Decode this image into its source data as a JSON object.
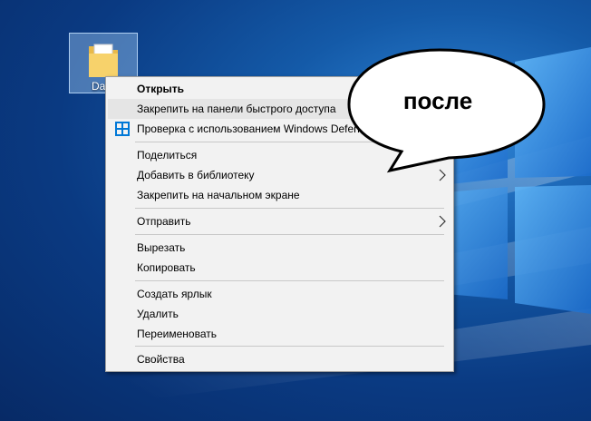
{
  "desktop": {
    "icon_label": "Da"
  },
  "context_menu": {
    "items": [
      {
        "label": "Открыть"
      },
      {
        "label": "Закрепить на панели быстрого доступа"
      },
      {
        "label": "Проверка с использованием Windows Defender..."
      },
      {
        "label": "Поделиться"
      },
      {
        "label": "Добавить в библиотеку"
      },
      {
        "label": "Закрепить на начальном экране"
      },
      {
        "label": "Отправить"
      },
      {
        "label": "Вырезать"
      },
      {
        "label": "Копировать"
      },
      {
        "label": "Создать ярлык"
      },
      {
        "label": "Удалить"
      },
      {
        "label": "Переименовать"
      },
      {
        "label": "Свойства"
      }
    ]
  },
  "annotation": {
    "bubble_text": "после"
  },
  "colors": {
    "menu_background": "#f2f2f2",
    "menu_highlight": "#e5e5e5",
    "defender_icon": "#0078d7",
    "wallpaper_dark": "#072a66",
    "wallpaper_light": "#2f86d8"
  },
  "icons": {
    "folder": "folder-icon",
    "defender": "windows-defender-icon",
    "submenu": "chevron-right-icon"
  }
}
